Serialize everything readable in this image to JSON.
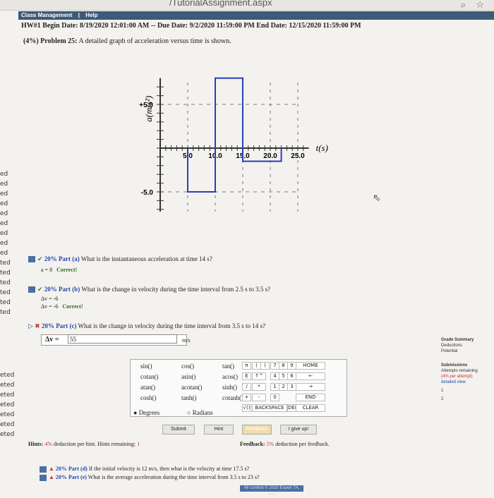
{
  "browser": {
    "url_fragment": "/TutorialAssignment.aspx",
    "icons": [
      "search-icon",
      "star-icon"
    ]
  },
  "nav": {
    "items": [
      "Class Management",
      "|",
      "Help"
    ]
  },
  "header": {
    "line1": "HW#1 Begin Date: 8/19/2020 12:01:00 AM -- Due Date: 9/2/2020 11:59:00 PM End Date: 12/15/2020 11:59:00 PM",
    "problem_pct": "(4%)",
    "problem_label": "Problem 25:",
    "problem_text": "A detailed graph of acceleration versus time is shown."
  },
  "chart_data": {
    "type": "line",
    "ylabel": "a(m/s²)",
    "xlabel": "t(s)",
    "x_ticks": [
      "5.0",
      "10.0",
      "15.0",
      "20.0",
      "25.0"
    ],
    "y_ticks": [
      "+5.0",
      "-5.0"
    ],
    "xlim": [
      0,
      27
    ],
    "ylim": [
      -8,
      8
    ],
    "series": [
      {
        "x": [
          5,
          5,
          10,
          10,
          15,
          15,
          22,
          22
        ],
        "y": [
          0,
          -5,
          -5,
          8,
          8,
          -1.5,
          -1.5,
          0
        ]
      }
    ]
  },
  "left_list": [
    "ed",
    "ed",
    "ed",
    "ed",
    "ed",
    "ed",
    "ed",
    "ed",
    "ed",
    "ted",
    "ted",
    "ted",
    "ted",
    "ted",
    "ted"
  ],
  "left_list2": [
    "eted",
    "eted",
    "eted",
    "eted",
    "eted",
    "eted",
    "eted"
  ],
  "parts": {
    "a": {
      "pct": "20% Part (a)",
      "question": "What is the instantaneous acceleration at time 14 s?",
      "answer": "a = 8",
      "result": "Correct!"
    },
    "b": {
      "pct": "20% Part (b)",
      "question": "What is the change in velocity during the time interval from 2.5 s to 3.5 s?",
      "ans1": "Δv = -6",
      "ans2": "Δv = -6",
      "result": "Correct!"
    },
    "c": {
      "pct": "20% Part (c)",
      "question": "What is the change in velocity during the time interval from 3.5 s to 14 s?",
      "label": "Δv =",
      "value": "55",
      "units": "m/s"
    },
    "d": {
      "pct": "20% Part (d)",
      "question": "If the initial velocity is 12 m/s, then what is the velocity at time 17.5 s?"
    },
    "e": {
      "pct": "20% Part (e)",
      "question": "What is the average acceleration during the time interval from 3.5 s to 23 s?"
    }
  },
  "calculator": {
    "functions": [
      [
        "sin()",
        "cos()",
        "tan()"
      ],
      [
        "cotan()",
        "asin()",
        "acos()"
      ],
      [
        "atan()",
        "acotan()",
        "sinh()"
      ],
      [
        "cosh()",
        "tanh()",
        "cotanh()"
      ]
    ],
    "mode_degrees": "Degrees",
    "mode_radians": "Radians",
    "keys": [
      "π",
      "(",
      ")",
      "7",
      "8",
      "9",
      "HOME",
      "E",
      "↑^",
      "4",
      "5",
      "6",
      "←",
      "/",
      "*",
      "1",
      "2",
      "3",
      "→",
      "+",
      "-",
      "0",
      "END",
      "√()",
      "BACKSPACE",
      "DEL",
      "CLEAR"
    ]
  },
  "buttons": {
    "submit": "Submit",
    "hint": "Hint",
    "feedback": "Feedback",
    "giveup": "I give up!"
  },
  "hints": {
    "label": "Hints:",
    "pct": "4%",
    "text": "deduction per hint. Hints remaining:",
    "remaining": "1"
  },
  "feedback": {
    "label": "Feedback:",
    "pct": "5%",
    "text": "deduction per feedback."
  },
  "side_panel": {
    "grade_summary": "Grade Summary",
    "deductions": "Deductions",
    "potential": "Potential",
    "submissions": "Submissions",
    "attempts": "Attempts remaining",
    "per_attempt": "(4% per attempt)",
    "detailed": "detailed view",
    "n1": "1",
    "n2": "2"
  },
  "footer": "All content © 2020 Expert TA, LLC"
}
